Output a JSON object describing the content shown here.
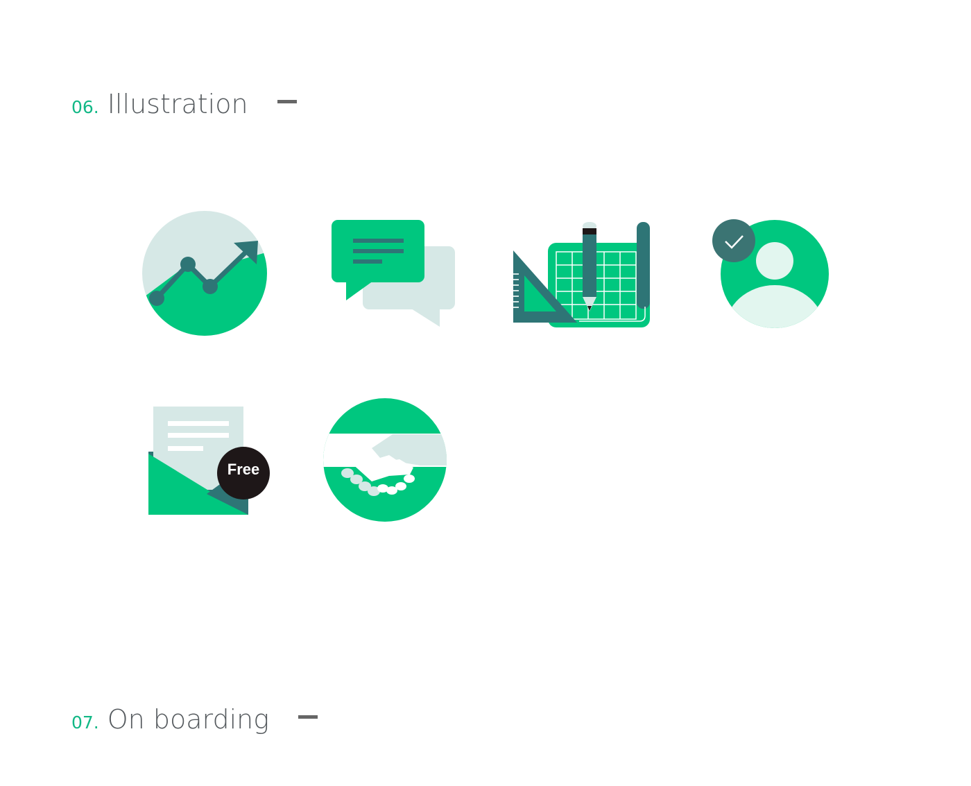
{
  "sections": [
    {
      "number": "06.",
      "title": "Illustration"
    },
    {
      "number": "07.",
      "title": "On boarding"
    }
  ],
  "illustrations": [
    {
      "icon": "growth-chart-icon"
    },
    {
      "icon": "chat-bubbles-icon"
    },
    {
      "icon": "blueprint-tools-icon"
    },
    {
      "icon": "verified-user-icon"
    },
    {
      "icon": "free-mail-icon",
      "badge": "Free"
    },
    {
      "icon": "handshake-icon"
    }
  ],
  "colors": {
    "green": "#00c77f",
    "teal": "#2e7576",
    "pale": "#d6e8e6",
    "mint": "#e2f6ef",
    "dark": "#1e1718",
    "accent_text": "#12b886",
    "title_text": "#555a5e"
  }
}
